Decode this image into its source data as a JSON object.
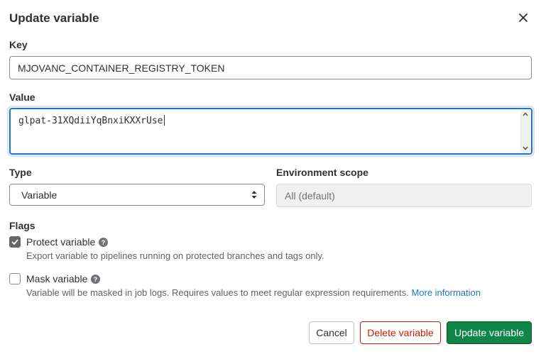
{
  "modal": {
    "title": "Update variable",
    "close_icon": "close-icon"
  },
  "form": {
    "key": {
      "label": "Key",
      "value": "MJOVANC_CONTAINER_REGISTRY_TOKEN"
    },
    "value": {
      "label": "Value",
      "value": "glpat-31XQdiiYqBnxiKXXrUse"
    },
    "type": {
      "label": "Type",
      "selected": "Variable"
    },
    "environment_scope": {
      "label": "Environment scope",
      "value": "All (default)"
    },
    "flags": {
      "label": "Flags",
      "protect": {
        "label": "Protect variable",
        "checked": true,
        "help": "Export variable to pipelines running on protected branches and tags only."
      },
      "mask": {
        "label": "Mask variable",
        "checked": false,
        "help": "Variable will be masked in job logs. Requires values to meet regular expression requirements.",
        "link": "More information"
      }
    }
  },
  "footer": {
    "cancel": "Cancel",
    "delete": "Delete variable",
    "update": "Update variable"
  },
  "colors": {
    "primary": "#108548",
    "danger": "#c91c00",
    "focus": "#1f75cb"
  }
}
